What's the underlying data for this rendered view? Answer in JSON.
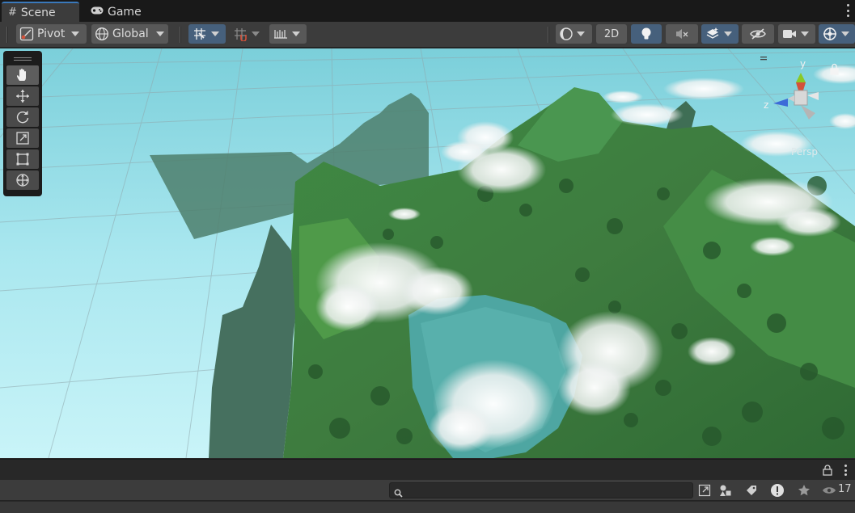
{
  "tabs": [
    {
      "label": "Scene",
      "icon": "grid-icon",
      "active": true
    },
    {
      "label": "Game",
      "icon": "gamepad-icon",
      "active": false
    }
  ],
  "toolbar": {
    "pivot_label": "Pivot",
    "global_label": "Global",
    "twod_label": "2D"
  },
  "gizmo": {
    "y_label": "y",
    "z_label": "z",
    "persp_label": "Persp"
  },
  "bottom": {
    "search_value": "",
    "visible_count": "17"
  },
  "colors": {
    "accent": "#3a79bb",
    "active_button": "#46607c",
    "sky": "#a6e6ef"
  }
}
